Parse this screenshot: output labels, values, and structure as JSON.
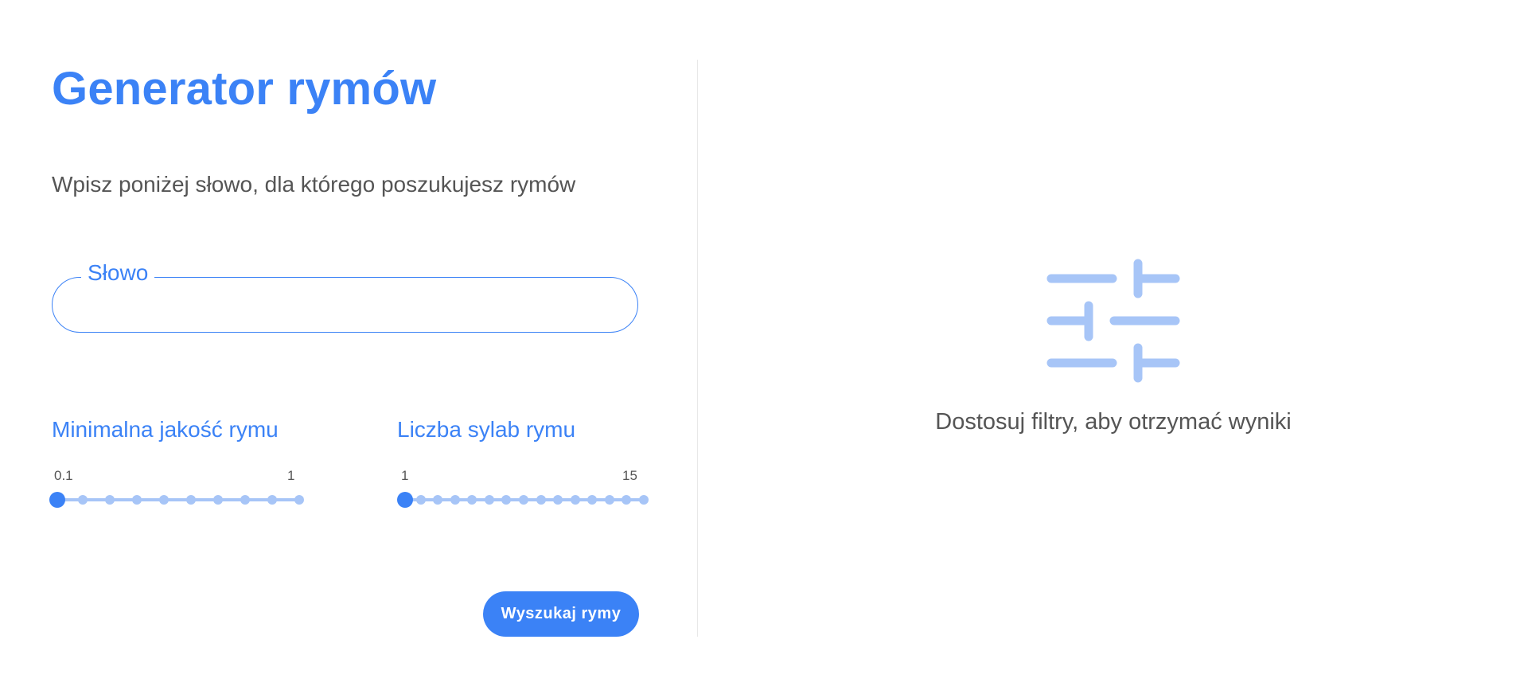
{
  "header": {
    "title": "Generator rymów",
    "subtitle": "Wpisz poniżej słowo, dla którego poszukujesz rymów"
  },
  "word_field": {
    "label": "Słowo",
    "value": "",
    "placeholder": ""
  },
  "quality_slider": {
    "label": "Minimalna jakość rymu",
    "min_label": "0.1",
    "max_label": "1",
    "min": 0.1,
    "max": 1,
    "step": 0.1,
    "value": 0.1
  },
  "syllables_slider": {
    "label": "Liczba sylab rymu",
    "min_label": "1",
    "max_label": "15",
    "min": 1,
    "max": 15,
    "step": 1,
    "value": 1
  },
  "actions": {
    "search_label": "Wyszukaj rymy"
  },
  "results": {
    "empty_message": "Dostosuj filtry, aby otrzymać wyniki",
    "icon": "sliders-icon"
  },
  "colors": {
    "accent": "#3b82f6",
    "accent_light": "#a7c5f7",
    "text": "#555555",
    "divider": "#e8e8e8"
  }
}
